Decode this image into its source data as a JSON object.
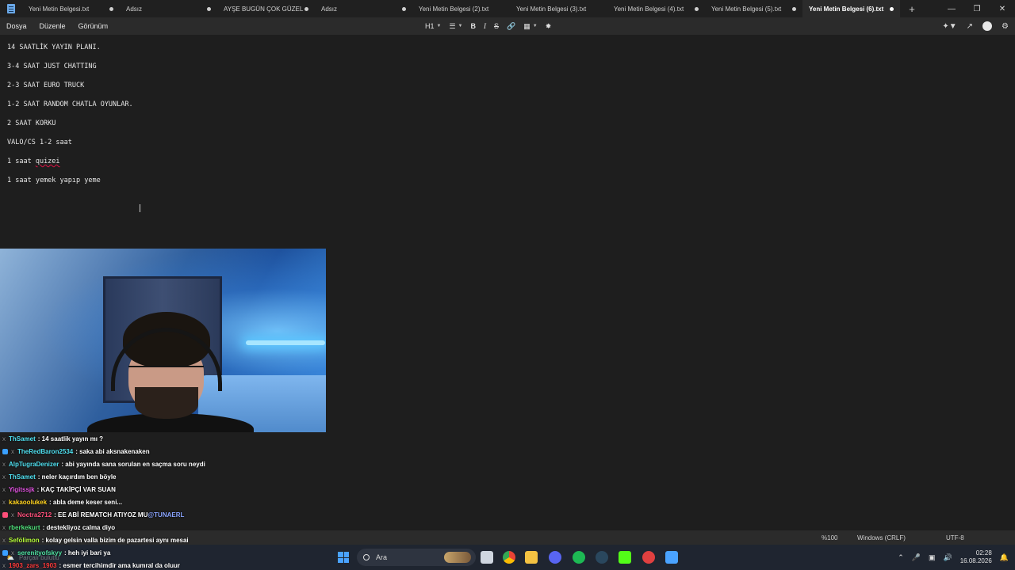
{
  "tabs": [
    {
      "label": "Yeni Metin Belgesi.txt",
      "active": false
    },
    {
      "label": "Adsız",
      "active": false
    },
    {
      "label": "AYŞE BUGÜN ÇOK GÜZEL",
      "active": false
    },
    {
      "label": "Adsız",
      "active": false
    },
    {
      "label": "Yeni Metin Belgesi (2).txt",
      "active": false
    },
    {
      "label": "Yeni Metin Belgesi (3).txt",
      "active": false
    },
    {
      "label": "Yeni Metin Belgesi (4).txt",
      "active": false
    },
    {
      "label": "Yeni Metin Belgesi (5).txt",
      "active": false
    },
    {
      "label": "Yeni Metin Belgesi (6).txt",
      "active": true
    }
  ],
  "menu": {
    "file": "Dosya",
    "edit": "Düzenle",
    "view": "Görünüm"
  },
  "toolbar": {
    "heading": "H1",
    "bold": "B",
    "italic": "I",
    "strike": "S"
  },
  "document": {
    "lines": [
      "14 SAATLİK YAYIN PLANI.",
      "3-4 SAAT JUST CHATTING",
      "2-3 SAAT EURO TRUCK",
      "1-2 SAAT RANDOM CHATLA OYUNLAR.",
      "2 SAAT KORKU",
      "VALO/CS 1-2 saat",
      "1 saat ",
      "1 saat yemek yapıp yeme"
    ],
    "misspelled_word": "quizei"
  },
  "chat": [
    {
      "user": "ThSamet",
      "color": "#4fe0f0",
      "message": ": 14 saatlik yayın mı ?",
      "badge": null
    },
    {
      "user": "TheRedBaron2534",
      "color": "#4fe0f0",
      "message": ": saka abi aksnakenaken",
      "badge": "#3aa0ff"
    },
    {
      "user": "AlpTugraDenizer",
      "color": "#4fe0f0",
      "message": ": abi yayında sana sorulan en saçma soru neydi",
      "badge": null
    },
    {
      "user": "ThSamet",
      "color": "#4fe0f0",
      "message": ": neler kaçırdım ben böyle",
      "badge": null
    },
    {
      "user": "Yigitssjk",
      "color": "#e052e0",
      "message": ": KAÇ TAKİPÇİ VAR SUAN",
      "badge": null
    },
    {
      "user": "kakaoolukek",
      "color": "#ffd21f",
      "message": ": abla deme keser seni...",
      "badge": null
    },
    {
      "user": "Noctra2712",
      "color": "#ff4f7a",
      "message": ": EE ABİ REMATCH ATIYOZ MU ",
      "badge": "#ff4f7a",
      "mention": "@TUNAERL"
    },
    {
      "user": "rberkekurt",
      "color": "#4fe07a",
      "message": ": destekliyoz calma diyo",
      "badge": null
    },
    {
      "user": "Sefölimon",
      "color": "#b6ff3a",
      "message": ": kolay gelsin valla bizim de pazartesi aynı mesai",
      "badge": null
    },
    {
      "user": "serenityofskyy",
      "color": "#4fe0a0",
      "message": ": heh iyi bari ya",
      "badge": "#3aa0ff"
    },
    {
      "user": "1903_zars_1903",
      "color": "#ff3a3a",
      "message": ": esmer tercihimdir ama kumral da oluur",
      "badge": null
    }
  ],
  "statusbar": {
    "zoom": "%100",
    "line_ending": "Windows (CRLF)",
    "encoding": "UTF-8"
  },
  "taskbar": {
    "search_placeholder": "Ara",
    "time": "02:28",
    "date": "16.08.2026",
    "widget_text": "Parçalı bulutlu"
  }
}
